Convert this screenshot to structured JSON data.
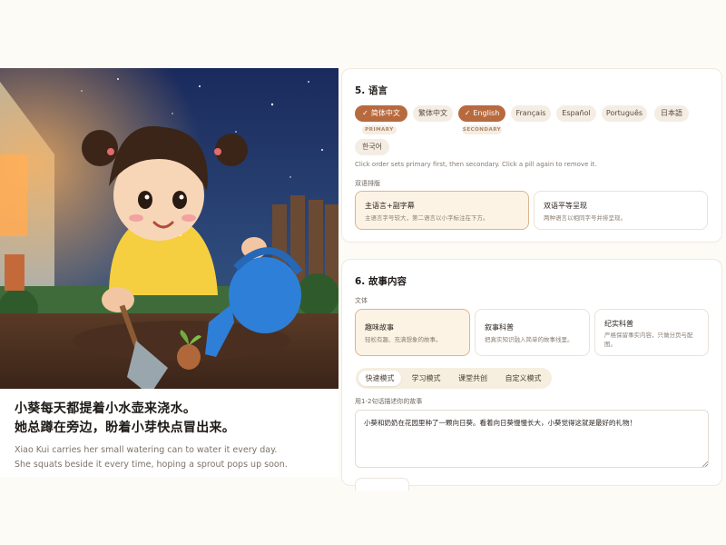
{
  "story": {
    "zh_lines": [
      "小葵每天都提着小水壶来浇水。",
      "她总蹲在旁边，盼着小芽快点冒出来。"
    ],
    "en_lines": [
      "Xiao Kui carries her small watering can to water it every day.",
      "She squats beside it every time, hoping a sprout pops up soon."
    ]
  },
  "language": {
    "title": "5. 语言",
    "pills": [
      {
        "label": "简体中文",
        "active": true,
        "role": "PRIMARY"
      },
      {
        "label": "繁体中文",
        "active": false
      },
      {
        "label": "English",
        "active": true,
        "role": "SECONDARY"
      },
      {
        "label": "Français",
        "active": false
      },
      {
        "label": "Español",
        "active": false
      },
      {
        "label": "Português",
        "active": false
      },
      {
        "label": "日本語",
        "active": false
      },
      {
        "label": "한국어",
        "active": false
      }
    ],
    "check_icon": "✓",
    "hint": "Click order sets primary first, then secondary. Click a pill again to remove it.",
    "layout_label": "双语排版",
    "layouts": [
      {
        "title": "主语言+副字幕",
        "desc": "主语言字号较大，第二语言以小字标注在下方。",
        "selected": true
      },
      {
        "title": "双语平等呈现",
        "desc": "两种语言以相同字号并排呈现。",
        "selected": false
      }
    ]
  },
  "content": {
    "title": "6. 故事内容",
    "genre_label": "文体",
    "genres": [
      {
        "title": "趣味故事",
        "desc": "轻松有趣、充满想象的故事。",
        "selected": true
      },
      {
        "title": "叙事科普",
        "desc": "把真实知识融入简单的故事线里。",
        "selected": false
      },
      {
        "title": "纪实科普",
        "desc": "严格保留事实内容，只做分页与配图。",
        "selected": false
      }
    ],
    "modes": [
      {
        "label": "快速模式",
        "active": true
      },
      {
        "label": "学习模式",
        "active": false
      },
      {
        "label": "课堂共创",
        "active": false
      },
      {
        "label": "自定义模式",
        "active": false
      }
    ],
    "input_label": "用1-2句话描述你的故事",
    "input_value": "小葵和奶奶在花园里种了一颗向日葵。看着向日葵慢慢长大，小葵觉得这就是最好的礼物！"
  },
  "colors": {
    "accent": "#b86a3f",
    "pill_bg": "#f4ede3",
    "selected_card": "#fdf3e4"
  }
}
